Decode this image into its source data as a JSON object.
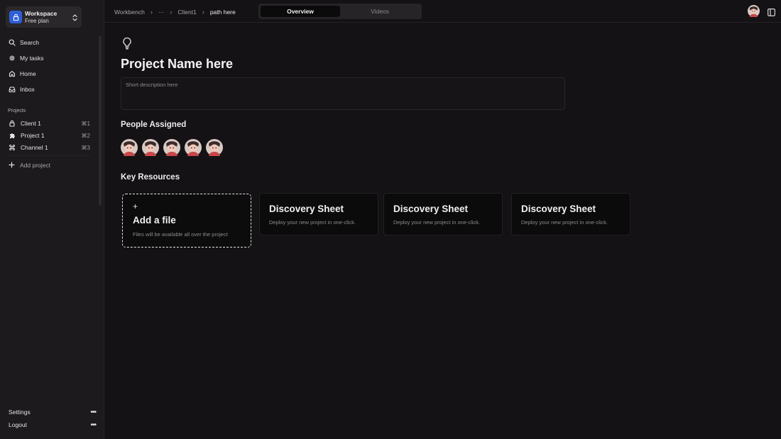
{
  "sidebar": {
    "workspace": {
      "title": "Workspace",
      "plan": "Free plan"
    },
    "nav": [
      {
        "label": "Search",
        "icon": "search-icon"
      },
      {
        "label": "My tasks",
        "icon": "tasks-icon"
      },
      {
        "label": "Home",
        "icon": "home-icon"
      },
      {
        "label": "Inbox",
        "icon": "inbox-icon"
      }
    ],
    "projects_label": "Projects",
    "projects": [
      {
        "label": "Client 1",
        "shortcut": "⌘1",
        "icon": "lock-icon"
      },
      {
        "label": "Project 1",
        "shortcut": "⌘2",
        "icon": "puzzle-icon"
      },
      {
        "label": "Channel 1",
        "shortcut": "⌘3",
        "icon": "command-icon"
      }
    ],
    "add_project": "Add project",
    "bottom": [
      {
        "label": "Settings"
      },
      {
        "label": "Logout"
      }
    ]
  },
  "topbar": {
    "breadcrumbs": [
      "Workbench",
      "···",
      "Client1",
      "path here"
    ],
    "tabs": [
      {
        "label": "Overview",
        "active": true
      },
      {
        "label": "Videos",
        "active": false
      }
    ]
  },
  "main": {
    "title": "Project Name here",
    "description_placeholder": "Short description here",
    "people_heading": "People Assigned",
    "people_count": 5,
    "resources_heading": "Key Resources",
    "add_file": {
      "plus": "+",
      "title": "Add a file",
      "subtitle": "Files will be available all over the project"
    },
    "resources": [
      {
        "title": "Discovery Sheet",
        "subtitle": "Deploy your new project in one-click."
      },
      {
        "title": "Discovery Sheet",
        "subtitle": "Deploy your new project in one-click."
      },
      {
        "title": "Discovery Sheet",
        "subtitle": "Deploy your new project in one-click."
      }
    ]
  },
  "colors": {
    "background": "#141214",
    "sidebar": "#1c1a1c",
    "accent": "#2f5fd6",
    "text": "#e8e6e8",
    "muted": "#8e8b8e"
  }
}
